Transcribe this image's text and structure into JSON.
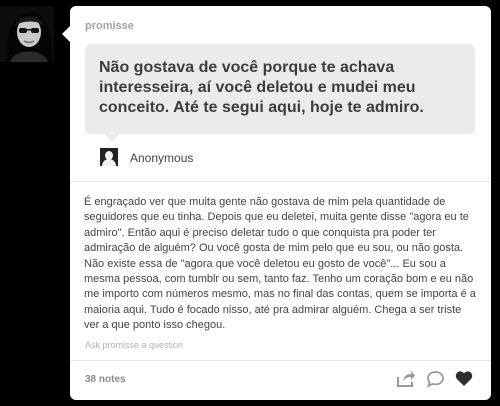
{
  "post": {
    "username": "promisse",
    "question": "Não gostava de você porque te achava interesseira, aí você deletou e mudei meu conceito. Até te segui aqui, hoje te admiro.",
    "asker": "Anonymous",
    "answer": "É engraçado ver que muita gente não gostava de mim pela quantidade de seguidores que eu tinha. Depois que eu deletei, muita gente disse \"agora eu te admiro\". Então aqui é preciso deletar tudo o que conquista pra poder ter admiração de alguém? Ou você gosta de mim pelo que eu sou, ou não gosta. Não existe essa de \"agora que você deletou eu gosto de você\"... Eu sou a mesma pessoa, com tumblr ou sem, tanto faz. Tenho um coração bom e eu não me importo com números mesmo, mas no final das contas, quem se importa é a maioria aqui. Tudo é focado nisso, até pra admirar alguém. Chega a ser triste ver a que ponto isso chegou.",
    "ask_link": "Ask promisse a question",
    "notes": "38 notes"
  },
  "icons": {
    "share": "share-arrow-icon",
    "reply": "speech-bubble-icon",
    "like": "heart-icon",
    "asker": "anonymous-avatar-icon"
  },
  "colors": {
    "background": "#000000",
    "card": "#ffffff",
    "bubble": "#ebebeb",
    "text": "#444444",
    "muted": "#a3a3a3"
  }
}
